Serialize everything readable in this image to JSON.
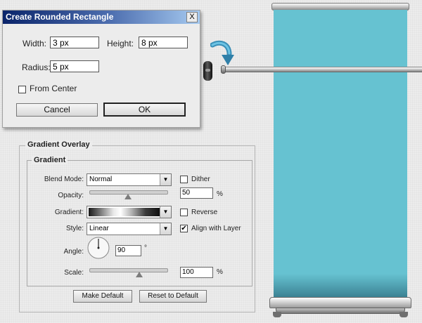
{
  "dialog": {
    "title": "Create Rounded Rectangle",
    "close_label": "X",
    "width_label": "Width:",
    "width_value": "3 px",
    "height_label": "Height:",
    "height_value": "8 px",
    "radius_label": "Radius:",
    "radius_value": "5 px",
    "from_center_label": "From Center",
    "from_center_checked": false,
    "cancel_label": "Cancel",
    "ok_label": "OK"
  },
  "gradient_overlay": {
    "title": "Gradient Overlay",
    "section_title": "Gradient",
    "blend_mode_label": "Blend Mode:",
    "blend_mode_value": "Normal",
    "dither_label": "Dither",
    "dither_checked": false,
    "opacity_label": "Opacity:",
    "opacity_value": "50",
    "opacity_unit": "%",
    "opacity_level": 50,
    "gradient_label": "Gradient:",
    "reverse_label": "Reverse",
    "reverse_checked": false,
    "style_label": "Style:",
    "style_value": "Linear",
    "align_label": "Align with Layer",
    "align_checked": true,
    "check_mark": "✔",
    "angle_label": "Angle:",
    "angle_value": "90",
    "angle_unit": "°",
    "scale_label": "Scale:",
    "scale_value": "100",
    "scale_unit": "%",
    "scale_level": 100,
    "make_default_label": "Make Default",
    "reset_default_label": "Reset to Default"
  },
  "icons": {
    "dropdown": "▼"
  },
  "colors": {
    "banner": "#66c2d1",
    "title_bar": "#0a246a",
    "arrow": "#3a8fb7"
  }
}
